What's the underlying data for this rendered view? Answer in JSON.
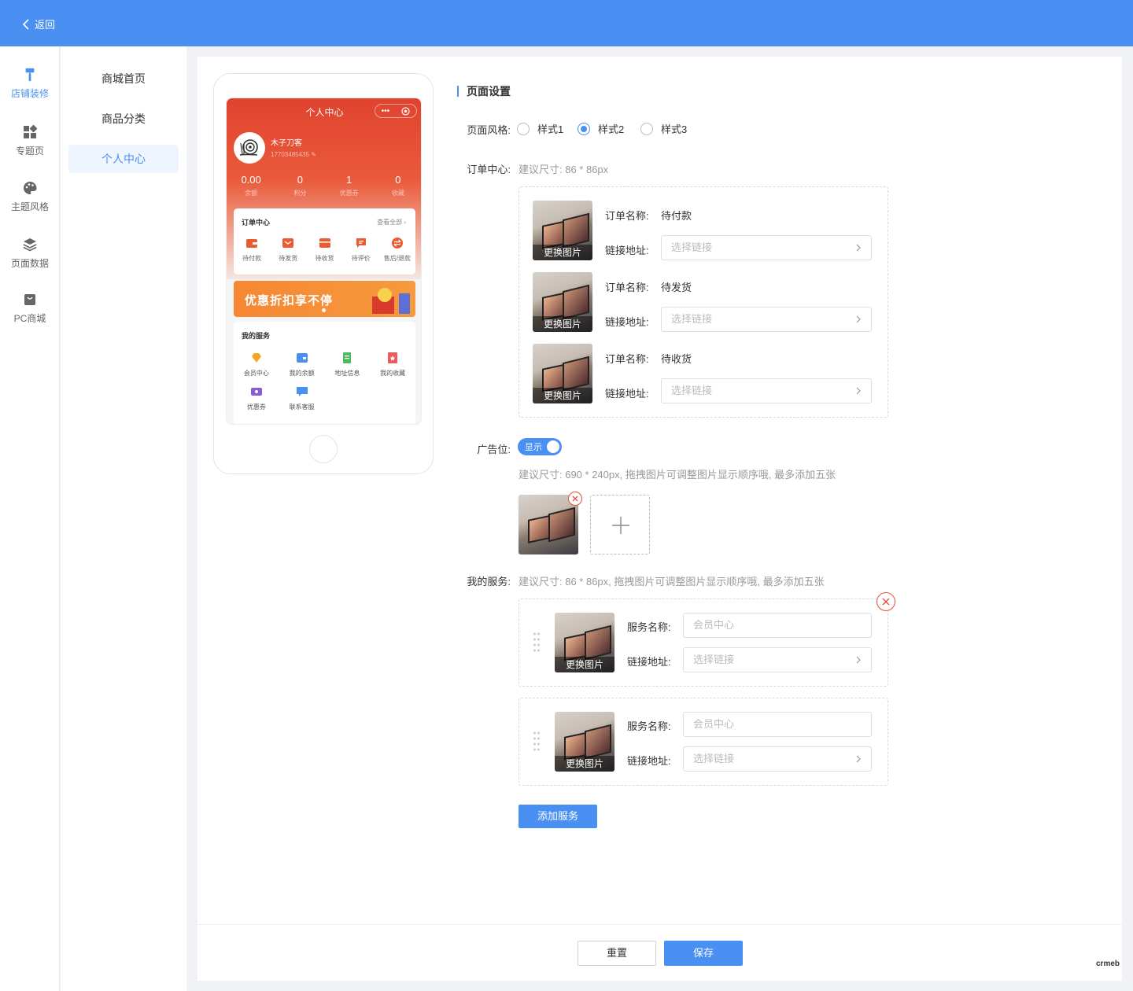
{
  "topbar": {
    "back_label": "返回"
  },
  "rail": {
    "items": [
      {
        "label": "店铺装修",
        "icon": "paint-roller-icon",
        "active": true
      },
      {
        "label": "专题页",
        "icon": "grid-icon"
      },
      {
        "label": "主题风格",
        "icon": "palette-icon"
      },
      {
        "label": "页面数据",
        "icon": "layers-icon"
      },
      {
        "label": "PC商城",
        "icon": "bag-icon"
      }
    ]
  },
  "subnav": {
    "items": [
      {
        "label": "商城首页"
      },
      {
        "label": "商品分类"
      },
      {
        "label": "个人中心",
        "active": true
      }
    ]
  },
  "phone": {
    "title": "个人中心",
    "caps": "•••",
    "user_name": "木子刀客",
    "user_phone": "17703485435",
    "stats": [
      {
        "value": "0.00",
        "label": "余额"
      },
      {
        "value": "0",
        "label": "积分"
      },
      {
        "value": "1",
        "label": "优惠券"
      },
      {
        "value": "0",
        "label": "收藏"
      }
    ],
    "order_title": "订单中心",
    "order_more": "查看全部",
    "orders": [
      {
        "label": "待付款"
      },
      {
        "label": "待发货"
      },
      {
        "label": "待收货"
      },
      {
        "label": "待评价"
      },
      {
        "label": "售后/退款"
      }
    ],
    "banner_text": "优惠折扣享不停",
    "service_title": "我的服务",
    "services": [
      {
        "label": "会员中心"
      },
      {
        "label": "我的余额"
      },
      {
        "label": "地址信息"
      },
      {
        "label": "我的收藏"
      },
      {
        "label": "优惠券"
      },
      {
        "label": "联系客服"
      }
    ]
  },
  "form": {
    "section_title": "页面设置",
    "style_label": "页面风格:",
    "styles": [
      {
        "label": "样式1",
        "selected": false
      },
      {
        "label": "样式2",
        "selected": true
      },
      {
        "label": "样式3",
        "selected": false
      }
    ],
    "order_label": "订单中心:",
    "order_hint": "建议尺寸: 86 * 86px",
    "change_image": "更换图片",
    "order_name_label": "订单名称:",
    "link_label": "链接地址:",
    "link_placeholder": "选择链接",
    "order_items": [
      {
        "name": "待付款"
      },
      {
        "name": "待发货"
      },
      {
        "name": "待收货"
      }
    ],
    "ad_label": "广告位:",
    "ad_switch": "显示",
    "ad_hint": "建议尺寸: 690 * 240px, 拖拽图片可调整图片显示顺序哦, 最多添加五张",
    "service_label": "我的服务:",
    "service_hint": "建议尺寸: 86 * 86px, 拖拽图片可调整图片显示顺序哦, 最多添加五张",
    "service_name_label": "服务名称:",
    "service_name_placeholder": "会员中心",
    "add_service": "添加服务"
  },
  "footer": {
    "reset": "重置",
    "save": "保存",
    "watermark": "crmeb"
  },
  "colors": {
    "primary": "#4a90f2",
    "danger": "#e74c3c",
    "phone_header": "#e0432f"
  }
}
